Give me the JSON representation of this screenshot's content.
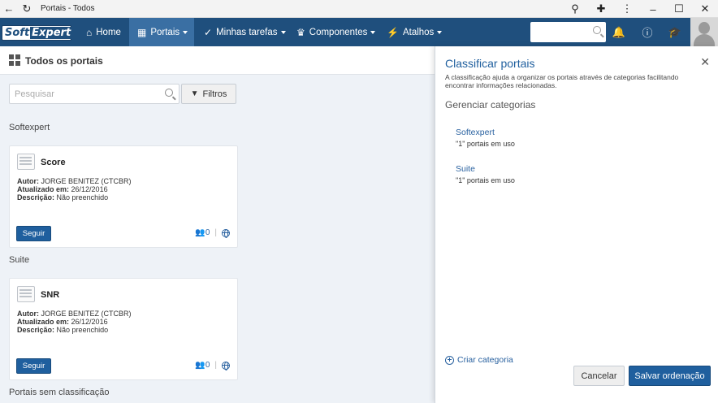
{
  "window": {
    "title": "Portais - Todos"
  },
  "nav": {
    "logo_part1": "Soft",
    "logo_part2": "Expert",
    "items": [
      {
        "label": "Home",
        "icon": "home-icon"
      },
      {
        "label": "Portais",
        "icon": "dashboard-icon"
      },
      {
        "label": "Minhas tarefas",
        "icon": "check-icon"
      },
      {
        "label": "Componentes",
        "icon": "trophy-icon"
      },
      {
        "label": "Atalhos",
        "icon": "bolt-icon"
      }
    ],
    "search_value": ""
  },
  "page": {
    "title": "Todos os portais",
    "search_placeholder": "Pesquisar",
    "filter_label": "Filtros"
  },
  "sections": [
    {
      "label": "Softexpert",
      "card": {
        "title": "Score",
        "author_label": "Autor:",
        "author": "JORGE BENITEZ (CTCBR)",
        "updated_label": "Atualizado em:",
        "updated": "26/12/2016",
        "desc_label": "Descrição:",
        "desc": "Não preenchido",
        "follow_label": "Seguir",
        "followers": "0"
      }
    },
    {
      "label": "Suite",
      "card": {
        "title": "SNR",
        "author_label": "Autor:",
        "author": "JORGE BENITEZ (CTCBR)",
        "updated_label": "Atualizado em:",
        "updated": "26/12/2016",
        "desc_label": "Descrição:",
        "desc": "Não preenchido",
        "follow_label": "Seguir",
        "followers": "0"
      }
    },
    {
      "label": "Portais sem classificação"
    }
  ],
  "panel": {
    "title": "Classificar portais",
    "description": "A classificação ajuda a organizar os portais através de categorias facilitando encontrar informações relacionadas.",
    "subtitle": "Gerenciar categorias",
    "categories": [
      {
        "name": "Softexpert",
        "count": "\"1\" portais em uso"
      },
      {
        "name": "Suite",
        "count": "\"1\" portais em uso"
      }
    ],
    "create_label": "Criar categoria",
    "cancel_label": "Cancelar",
    "save_label": "Salvar ordenação"
  }
}
